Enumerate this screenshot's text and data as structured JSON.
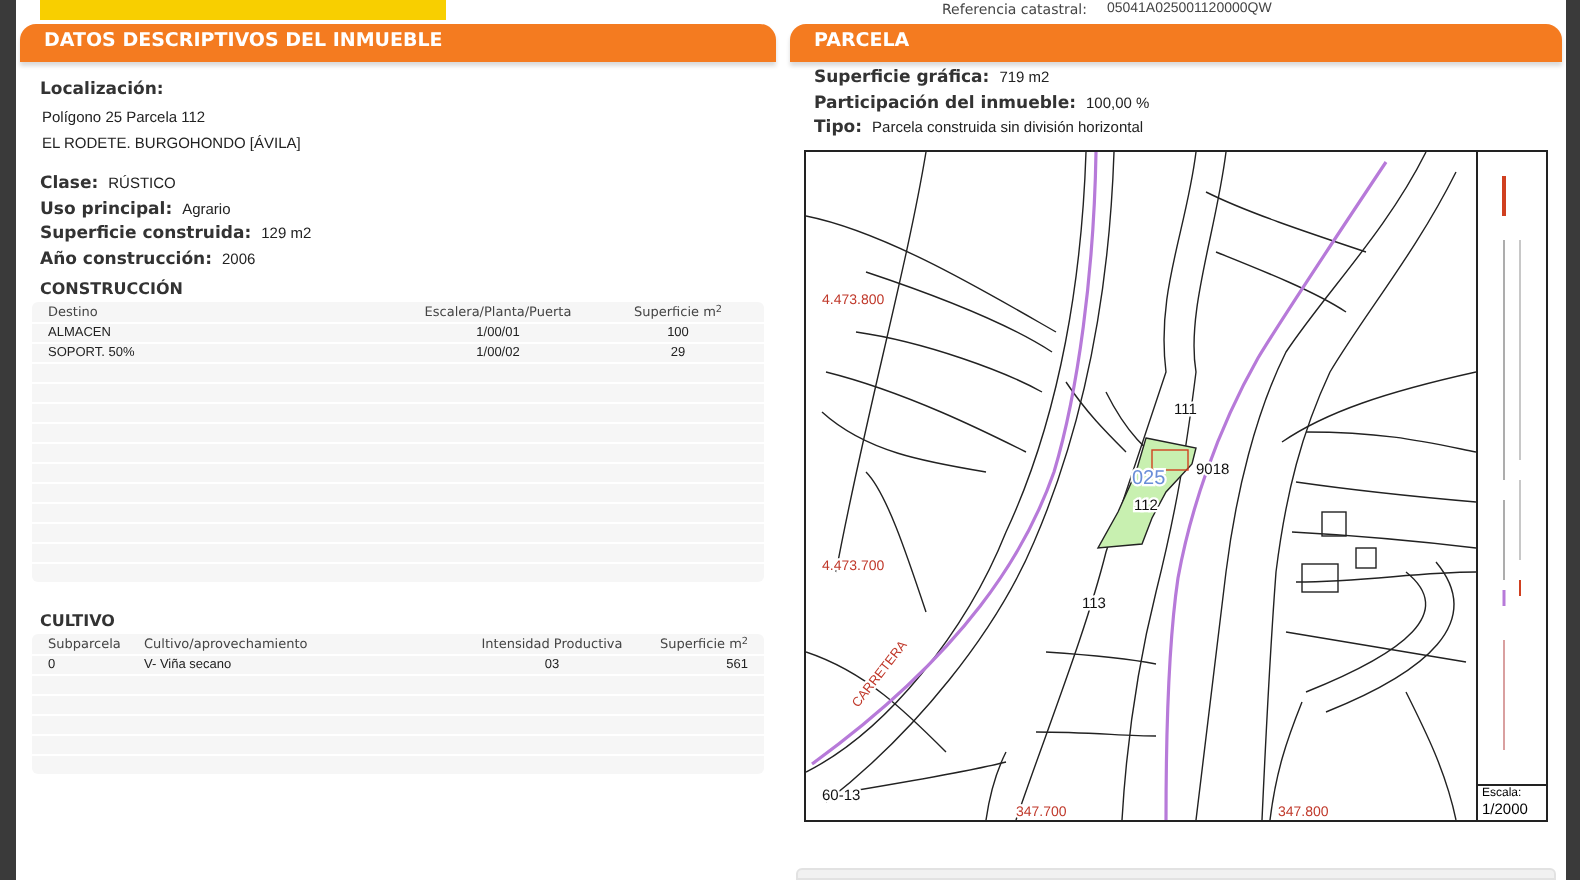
{
  "header": {
    "reference_label": "Referencia catastral:",
    "reference_value": "05041A025001120000QW"
  },
  "descriptive": {
    "title": "DATOS DESCRIPTIVOS DEL INMUEBLE",
    "location_label": "Localización:",
    "address_lines": [
      "Polígono 25 Parcela 112",
      "EL RODETE. BURGOHONDO [ÁVILA]"
    ],
    "fields": [
      {
        "label": "Clase:",
        "value": "RÚSTICO"
      },
      {
        "label": "Uso principal:",
        "value": "Agrario"
      },
      {
        "label": "Superficie construida:",
        "value": "129 m2"
      },
      {
        "label": "Año construcción:",
        "value": "2006"
      }
    ],
    "construction": {
      "title": "CONSTRUCCIÓN",
      "columns": [
        "Destino",
        "Escalera/Planta/Puerta",
        "Superficie m$^{2}$"
      ],
      "rows": [
        [
          "ALMACEN",
          "1/00/01",
          "100"
        ],
        [
          "SOPORT. 50%",
          "1/00/02",
          "29"
        ]
      ]
    },
    "crops": {
      "title": "CULTIVO",
      "columns": [
        "Subparcela",
        "Cultivo/aprovechamiento",
        "Intensidad Productiva",
        "Superficie m$^{2}$"
      ],
      "rows": [
        [
          "0",
          "V- Viña secano",
          "03",
          "561"
        ]
      ]
    }
  },
  "parcel": {
    "title": "PARCELA",
    "fields": [
      {
        "label": "Superficie gráfica:",
        "value": "719 m2"
      },
      {
        "label": "Participación del inmueble:",
        "value": "100,00 %"
      },
      {
        "label": "Tipo:",
        "value": "Parcela construida sin división horizontal"
      }
    ],
    "map": {
      "labels": [
        {
          "text": "4.473.800",
          "kind": "coordinate"
        },
        {
          "text": "4.473.700",
          "kind": "coordinate"
        },
        {
          "text": "347.700",
          "kind": "coordinate"
        },
        {
          "text": "347.800",
          "kind": "coordinate"
        },
        {
          "text": "111",
          "kind": "parcel"
        },
        {
          "text": "9018",
          "kind": "parcel"
        },
        {
          "text": "112",
          "kind": "parcel"
        },
        {
          "text": "113",
          "kind": "parcel"
        },
        {
          "text": "60-13",
          "kind": "parcel"
        },
        {
          "text": "025",
          "kind": "polygon"
        },
        {
          "text": "CARRETERA",
          "kind": "road"
        }
      ],
      "scale_label": "Escala:",
      "scale_value": "1/2000"
    }
  }
}
